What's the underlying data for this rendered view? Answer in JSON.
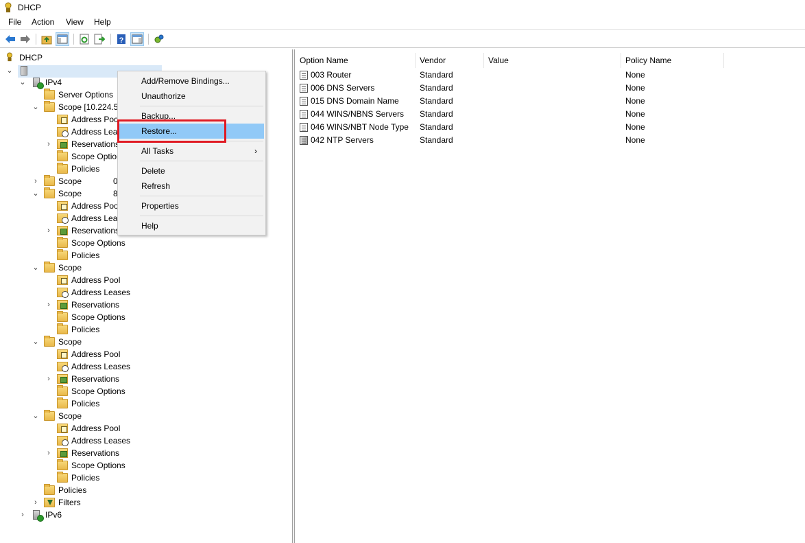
{
  "window": {
    "title": "DHCP"
  },
  "menubar": {
    "items": [
      "File",
      "Action",
      "View",
      "Help"
    ]
  },
  "toolbar": {
    "buttons": [
      "back-icon",
      "forward-icon",
      "up-folder-icon",
      "show-hide-tree-icon",
      "refresh-icon",
      "export-list-icon",
      "help-icon",
      "show-hide-action-pane-icon",
      "dhcp-server-icon"
    ]
  },
  "tree": {
    "root": "DHCP",
    "server_label": "",
    "ipv4": "IPv4",
    "server_options": "Server Options",
    "scope1": "Scope [10.224.52",
    "address_pool": "Address Pool",
    "address_leases": "Address Leases",
    "address_leases_trunc": "Address Leas",
    "address_pool_trunc": "Address Pool",
    "reservations": "Reservations",
    "scope_options": "Scope Options",
    "scope_options_trunc": "Scope Option",
    "policies": "Policies",
    "scope": "Scope",
    "scope2_suffix": "0",
    "scope3_suffix": "8",
    "filters": "Filters",
    "ipv6": "IPv6"
  },
  "list": {
    "columns": [
      "Option Name",
      "Vendor",
      "Value",
      "Policy Name"
    ],
    "rows": [
      {
        "name": "003 Router",
        "vendor": "Standard",
        "value": "",
        "policy": "None"
      },
      {
        "name": "006 DNS Servers",
        "vendor": "Standard",
        "value": "",
        "policy": "None"
      },
      {
        "name": "015 DNS Domain Name",
        "vendor": "Standard",
        "value": "",
        "policy": "None"
      },
      {
        "name": "044 WINS/NBNS Servers",
        "vendor": "Standard",
        "value": "",
        "policy": "None"
      },
      {
        "name": "046 WINS/NBT Node Type",
        "vendor": "Standard",
        "value": "",
        "policy": "None"
      },
      {
        "name": "042 NTP Servers",
        "vendor": "Standard",
        "value": "",
        "policy": "None"
      }
    ]
  },
  "context_menu": {
    "add_remove_bindings": "Add/Remove Bindings...",
    "unauthorize": "Unauthorize",
    "backup": "Backup...",
    "restore": "Restore...",
    "all_tasks": "All Tasks",
    "delete": "Delete",
    "refresh": "Refresh",
    "properties": "Properties",
    "help": "Help",
    "submenu_arrow": "›"
  },
  "colors": {
    "highlight_box": "#e01b24",
    "menu_hover": "#91c9f7"
  }
}
